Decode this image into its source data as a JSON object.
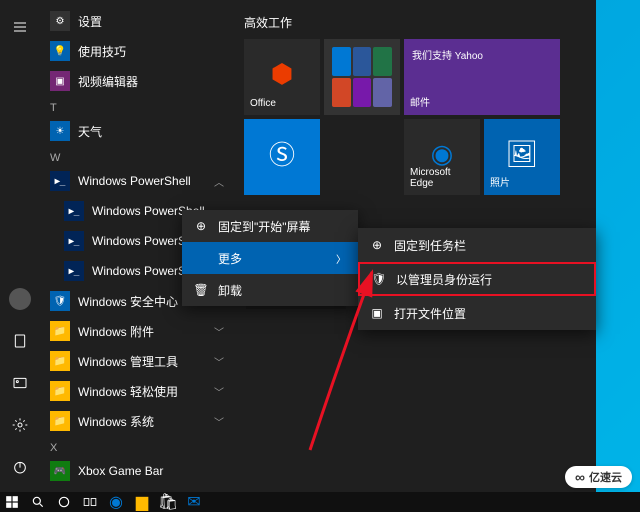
{
  "apps": {
    "setting": "设置",
    "tips": "使用技巧",
    "video": "视频编辑器",
    "hdr_t": "T",
    "weather": "天气",
    "hdr_w": "W",
    "ps_folder": "Windows PowerShell",
    "ps1": "Windows PowerShell",
    "ps2": "Windows PowerShell",
    "ps3": "Windows PowerShell",
    "sec": "Windows 安全中心",
    "acc": "Windows 附件",
    "admin": "Windows 管理工具",
    "ease": "Windows 轻松使用",
    "sys": "Windows 系统",
    "hdr_x": "X",
    "xbox": "Xbox Game Bar"
  },
  "tiles": {
    "group": "高效工作",
    "office": "Office",
    "yahoo": "我们支持 Yahoo",
    "mail": "邮件",
    "edge": "Microsoft Edge",
    "photo": "照片",
    "store": "Microsoft Store"
  },
  "ctx": {
    "pin_start": "固定到\"开始\"屏幕",
    "more": "更多",
    "uninstall": "卸载"
  },
  "subctx": {
    "pin_task": "固定到任务栏",
    "run_admin": "以管理员身份运行",
    "open_loc": "打开文件位置"
  },
  "watermark": "亿速云",
  "colors": {
    "outlook": "#0078d4",
    "word": "#2b579a",
    "excel": "#217346",
    "ppt": "#d24726",
    "onenote": "#7719aa",
    "teams": "#6264a7"
  }
}
